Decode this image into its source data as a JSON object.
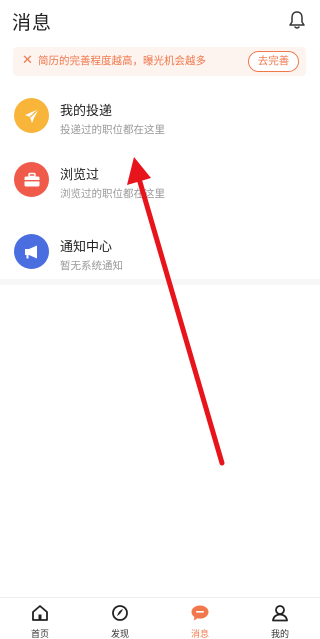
{
  "header": {
    "title": "消息",
    "bell_icon": "bell-icon"
  },
  "banner": {
    "close_icon": "close-icon",
    "text": "简历的完善程度越高，曝光机会越多",
    "button_label": "去完善",
    "accent": "#f0784c"
  },
  "items": [
    {
      "name": "我的投递",
      "desc": "投递过的职位都在这里",
      "icon": "paper-plane-icon",
      "color": "#f9b43a"
    },
    {
      "name": "浏览过",
      "desc": "浏览过的职位都在这里",
      "icon": "briefcase-icon",
      "color": "#f05a4a"
    },
    {
      "name": "通知中心",
      "desc": "暂无系统通知",
      "icon": "megaphone-icon",
      "color": "#4a6ee0"
    }
  ],
  "tabs": [
    {
      "label": "首页",
      "icon": "home-icon",
      "active": false
    },
    {
      "label": "发现",
      "icon": "discover-icon",
      "active": false
    },
    {
      "label": "消息",
      "icon": "message-icon",
      "active": true
    },
    {
      "label": "我的",
      "icon": "profile-icon",
      "active": false
    }
  ],
  "annotation": {
    "arrow_color": "#e8141c"
  }
}
